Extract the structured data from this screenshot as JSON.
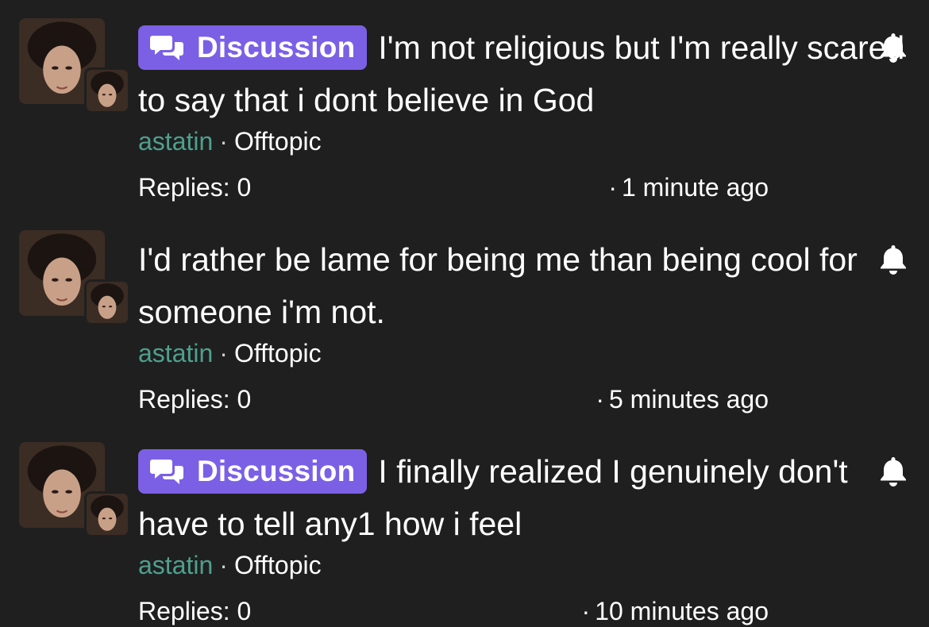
{
  "threads": [
    {
      "badge": "Discussion",
      "title": "I'm not religious but I'm really scared to say that i dont believe in God",
      "author": "astatin",
      "separator": "·",
      "category": "Offtopic",
      "replies": "Replies: 0",
      "time_dot": "·",
      "time": "1 minute ago",
      "icon": "bell-icon"
    },
    {
      "badge": "",
      "title": "I'd rather be lame for being me than being cool for someone i'm not.",
      "author": "astatin",
      "separator": "·",
      "category": "Offtopic",
      "replies": "Replies: 0",
      "time_dot": "·",
      "time": "5 minutes ago",
      "icon": "bell-icon"
    },
    {
      "badge": "Discussion",
      "title": "I finally realized I genuinely don't have to tell any1 how i feel",
      "author": "astatin",
      "separator": "·",
      "category": "Offtopic",
      "replies": "Replies: 0",
      "time_dot": "·",
      "time": "10 minutes ago",
      "icon": "bell-icon"
    }
  ],
  "colors": {
    "background": "#1f1f20",
    "badge": "#7b60e6",
    "author": "#4fa08b",
    "text": "#ffffff"
  }
}
